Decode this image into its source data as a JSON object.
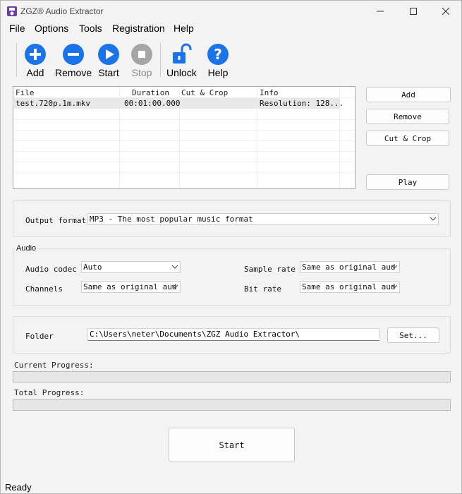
{
  "window": {
    "title": "ZGZ® Audio Extractor"
  },
  "menu": [
    "File",
    "Options",
    "Tools",
    "Registration",
    "Help"
  ],
  "toolbar": {
    "add": "Add",
    "remove": "Remove",
    "start": "Start",
    "stop": "Stop",
    "unlock": "Unlock",
    "help": "Help"
  },
  "colors": {
    "accent": "#1a73e8",
    "disabled": "#a6a6a6"
  },
  "filelist": {
    "columns": [
      "File",
      "Duration",
      "Cut & Crop",
      "Info"
    ],
    "rows": [
      {
        "file": "test.720p.1m.mkv",
        "duration": "00:01:00.000",
        "cut": "",
        "info": "Resolution: 128..."
      }
    ]
  },
  "side_buttons": {
    "add": "Add",
    "remove": "Remove",
    "cut_crop": "Cut & Crop",
    "play": "Play"
  },
  "output": {
    "label": "Output format",
    "value": "MP3 - The most popular music format"
  },
  "audio": {
    "title": "Audio",
    "codec_label": "Audio codec",
    "codec_value": "Auto",
    "channels_label": "Channels",
    "channels_value": "Same as original aud",
    "sample_rate_label": "Sample rate",
    "sample_rate_value": "Same as original aud",
    "bit_rate_label": "Bit rate",
    "bit_rate_value": "Same as original aud"
  },
  "folder": {
    "label": "Folder",
    "value": "C:\\Users\\neter\\Documents\\ZGZ Audio Extractor\\",
    "set_button": "Set..."
  },
  "progress": {
    "current_label": "Current Progress:",
    "current_value": 0,
    "total_label": "Total Progress:",
    "total_value": 0
  },
  "start_button": "Start",
  "status": "Ready"
}
